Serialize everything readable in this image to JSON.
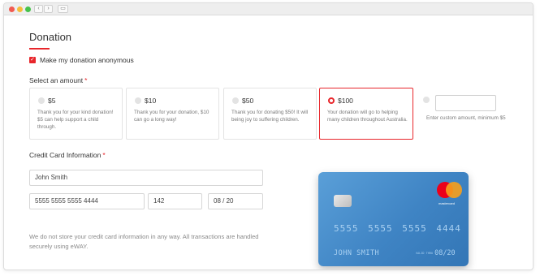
{
  "page": {
    "title": "Donation",
    "anonymous_label": "Make my donation anonymous",
    "select_amount_label": "Select an amount",
    "required_mark": "*"
  },
  "amounts": [
    {
      "value": "$5",
      "desc": "Thank you for your kind donation! $5 can help support a child through.",
      "selected": false
    },
    {
      "value": "$10",
      "desc": "Thank you for your donation, $10 can go a long way!",
      "selected": false
    },
    {
      "value": "$50",
      "desc": "Thank you for donating $50! It will being joy to suffering children.",
      "selected": false
    },
    {
      "value": "$100",
      "desc": "Your donation will go to helping many children throughout Australia.",
      "selected": true
    }
  ],
  "custom_amount": {
    "value": "",
    "desc": "Enter custom amount, minimum $5"
  },
  "card_section": {
    "label": "Credit Card Information",
    "name_value": "John Smith",
    "number_value": "5555 5555 5555 4444",
    "cvv_value": "142",
    "expiry_value": "08 / 20",
    "note": "We do not store your credit card information in any way. All transactions are handled securely using eWAY."
  },
  "card_preview": {
    "number": "5555 5555 5555 4444",
    "holder": "JOHN SMITH",
    "expiry_prefix": "VALID THRU",
    "expiry": "08/20",
    "brand": "mastercard"
  },
  "colors": {
    "accent": "#e8262b",
    "card_blue": "#3f84c4"
  }
}
